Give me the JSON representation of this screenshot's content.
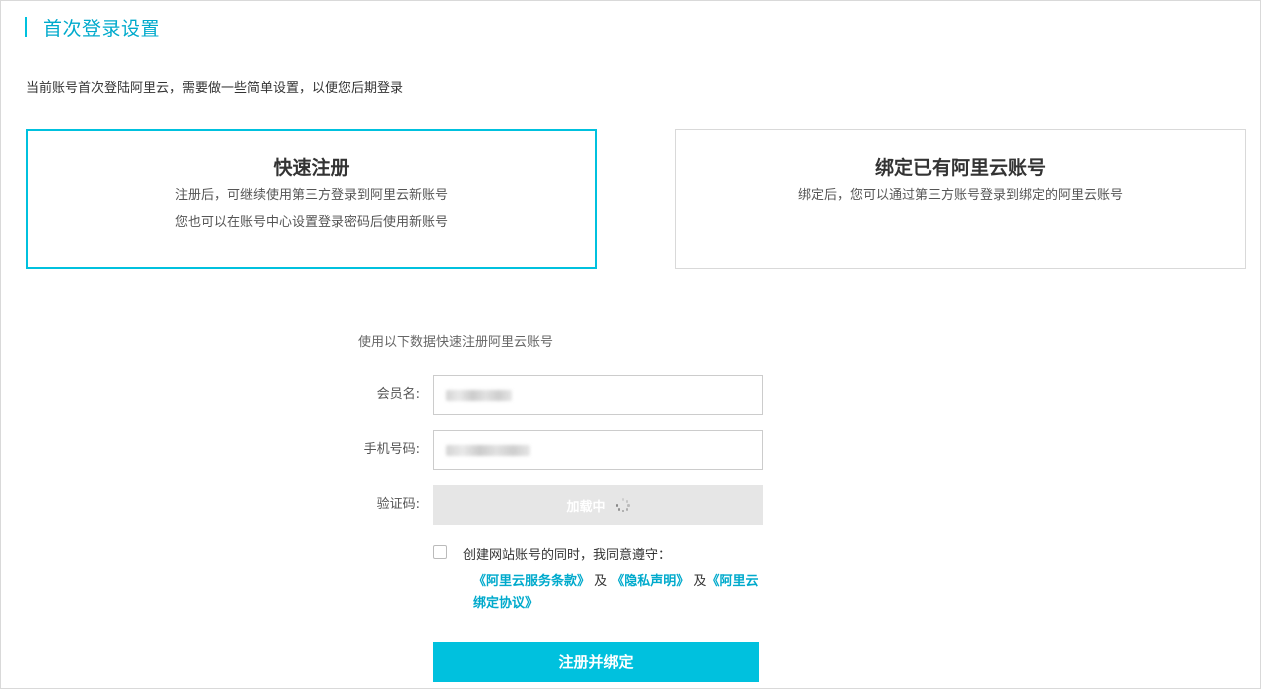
{
  "header": {
    "title": "首次登录设置",
    "accent_color": "#00c1de"
  },
  "intro": "当前账号首次登陆阿里云，需要做一些简单设置，以便您后期登录",
  "options": {
    "quick_register": {
      "title": "快速注册",
      "desc_line1": "注册后，可继续使用第三方登录到阿里云新账号",
      "desc_line2": "您也可以在账号中心设置登录密码后使用新账号",
      "selected": true
    },
    "bind_existing": {
      "title": "绑定已有阿里云账号",
      "desc_line1": "绑定后，您可以通过第三方账号登录到绑定的阿里云账号",
      "selected": false
    }
  },
  "form": {
    "subtitle": "使用以下数据快速注册阿里云账号",
    "member_name_label": "会员名:",
    "phone_label": "手机号码:",
    "captcha_label": "验证码:",
    "captcha_loading": "加载中",
    "agree_text": "创建网站账号的同时，我同意遵守：",
    "terms_service": "《阿里云服务条款》",
    "terms_sep1": " 及 ",
    "terms_privacy": "《隐私声明》",
    "terms_sep2": " 及",
    "terms_bind": "《阿里云绑定协议》",
    "submit_label": "注册并绑定"
  }
}
